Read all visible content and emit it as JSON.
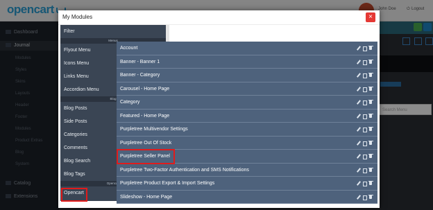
{
  "admin": {
    "logo": "opencart",
    "user": "John Doe",
    "logout": "Logout",
    "sidebar": [
      {
        "label": "Dashboard"
      },
      {
        "label": "Journal",
        "active": true
      },
      {
        "label": "Catalog"
      },
      {
        "label": "Extensions"
      }
    ],
    "sidebar_sub": [
      "Modules",
      "Styles",
      "Skins",
      "Layouts",
      "Header",
      "Footer",
      "Modules",
      "Product Extras",
      "Blog",
      "System"
    ],
    "search_placeholder": "Search Menu"
  },
  "modal": {
    "title": "My Modules",
    "close_label": "×",
    "module_types": [
      {
        "kind": "item",
        "label": "Filter"
      },
      {
        "kind": "header",
        "label": "Menus"
      },
      {
        "kind": "item",
        "label": "Flyout Menu"
      },
      {
        "kind": "item",
        "label": "Icons Menu"
      },
      {
        "kind": "item",
        "label": "Links Menu"
      },
      {
        "kind": "item",
        "label": "Accordion Menu"
      },
      {
        "kind": "header",
        "label": "Blog"
      },
      {
        "kind": "item",
        "label": "Blog Posts"
      },
      {
        "kind": "item",
        "label": "Side Posts"
      },
      {
        "kind": "item",
        "label": "Categories"
      },
      {
        "kind": "item",
        "label": "Comments"
      },
      {
        "kind": "item",
        "label": "Blog Search"
      },
      {
        "kind": "item",
        "label": "Blog Tags"
      },
      {
        "kind": "header",
        "label": "Opencart"
      },
      {
        "kind": "item",
        "label": "Opencart",
        "selected": true
      }
    ],
    "modules": [
      {
        "label": "Account"
      },
      {
        "label": "Banner - Banner 1"
      },
      {
        "label": "Banner - Category"
      },
      {
        "label": "Carousel - Home Page"
      },
      {
        "label": "Category"
      },
      {
        "label": "Featured - Home Page"
      },
      {
        "label": "Purpletree Multivendor Settings"
      },
      {
        "label": "Purpletree Out Of Stock"
      },
      {
        "label": "Purpletree Seller Panel",
        "highlighted": true
      },
      {
        "label": "Purpletree Two-Factor Authentication and SMS Notifications"
      },
      {
        "label": "Purpletree Product Export & Import Settings"
      },
      {
        "label": "Slideshow - Home Page"
      }
    ],
    "row_actions": [
      "pencil-icon",
      "copy-icon",
      "trash-icon"
    ],
    "colors": {
      "module_row": "#4e627c",
      "type_list": "#3a4554",
      "highlight": "#e21b1b",
      "close": "#e53935"
    }
  }
}
